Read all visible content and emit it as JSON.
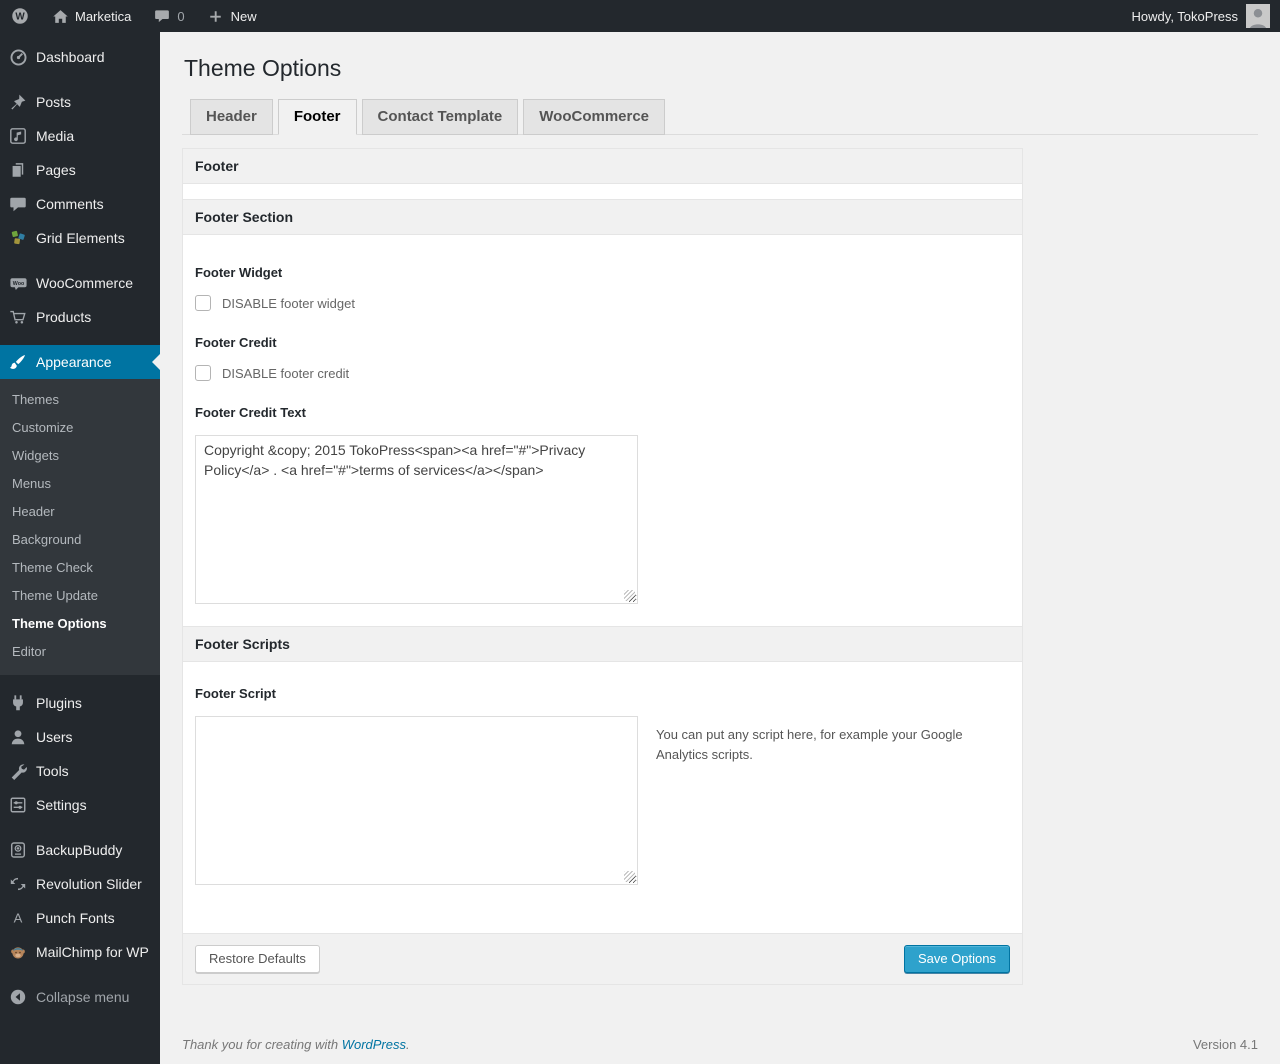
{
  "admin_bar": {
    "site_name": "Marketica",
    "comments_count": "0",
    "new_label": "New",
    "howdy": "Howdy, TokoPress"
  },
  "sidebar": {
    "groups": [
      {
        "items": [
          {
            "label": "Dashboard",
            "icon": "dashboard-icon"
          }
        ]
      },
      {
        "items": [
          {
            "label": "Posts",
            "icon": "pin-icon"
          },
          {
            "label": "Media",
            "icon": "media-icon"
          },
          {
            "label": "Pages",
            "icon": "pages-icon"
          },
          {
            "label": "Comments",
            "icon": "comment-icon"
          },
          {
            "label": "Grid Elements",
            "icon": "grid-elements-icon"
          }
        ]
      },
      {
        "items": [
          {
            "label": "WooCommerce",
            "icon": "woocommerce-icon"
          },
          {
            "label": "Products",
            "icon": "cart-icon"
          }
        ]
      },
      {
        "items": [
          {
            "label": "Appearance",
            "icon": "brush-icon",
            "active": true,
            "submenu": [
              "Themes",
              "Customize",
              "Widgets",
              "Menus",
              "Header",
              "Background",
              "Theme Check",
              "Theme Update",
              "Theme Options",
              "Editor"
            ],
            "current_submenu": "Theme Options"
          }
        ]
      },
      {
        "items": [
          {
            "label": "Plugins",
            "icon": "plugin-icon"
          },
          {
            "label": "Users",
            "icon": "user-icon"
          },
          {
            "label": "Tools",
            "icon": "wrench-icon"
          },
          {
            "label": "Settings",
            "icon": "sliders-icon"
          }
        ]
      },
      {
        "items": [
          {
            "label": "BackupBuddy",
            "icon": "backup-drive-icon"
          },
          {
            "label": "Revolution Slider",
            "icon": "refresh-icon"
          },
          {
            "label": "Punch Fonts",
            "icon": "letter-a-icon"
          },
          {
            "label": "MailChimp for WP",
            "icon": "monkey-icon"
          }
        ]
      },
      {
        "items": [
          {
            "label": "Collapse menu",
            "icon": "collapse-arrow-icon"
          }
        ]
      }
    ]
  },
  "main": {
    "page_title": "Theme Options",
    "tabs": [
      {
        "label": "Header",
        "active": false
      },
      {
        "label": "Footer",
        "active": true
      },
      {
        "label": "Contact Template",
        "active": false
      },
      {
        "label": "WooCommerce",
        "active": false
      }
    ],
    "panel": {
      "title": "Footer",
      "sections": [
        {
          "title": "Footer Section"
        },
        {
          "title": "Footer Scripts"
        }
      ],
      "fields": {
        "footer_widget": {
          "label": "Footer Widget",
          "checkbox_label": "DISABLE footer widget",
          "checked": false
        },
        "footer_credit": {
          "label": "Footer Credit",
          "checkbox_label": "DISABLE footer credit",
          "checked": false
        },
        "footer_credit_text": {
          "label": "Footer Credit Text",
          "value": "Copyright &copy; 2015 TokoPress<span><a href=\"#\">Privacy Policy</a> . <a href=\"#\">terms of services</a></span>"
        },
        "footer_script": {
          "label": "Footer Script",
          "value": "",
          "help": "You can put any script here, for example your Google Analytics scripts."
        }
      },
      "buttons": {
        "restore": "Restore Defaults",
        "save": "Save Options"
      }
    }
  },
  "page_footer": {
    "thanks_text": "Thank you for creating with ",
    "wordpress_link": "WordPress",
    "period": ".",
    "version": "Version 4.1"
  },
  "colors": {
    "admin_bar_bg": "#23282d",
    "sidebar_bg": "#23282d",
    "submenu_bg": "#32373c",
    "active_menu_blue": "#0074a2",
    "primary_button_blue": "#2ea2cc",
    "page_bg": "#f1f1f1",
    "panel_header_bg": "#f1f1f1"
  }
}
